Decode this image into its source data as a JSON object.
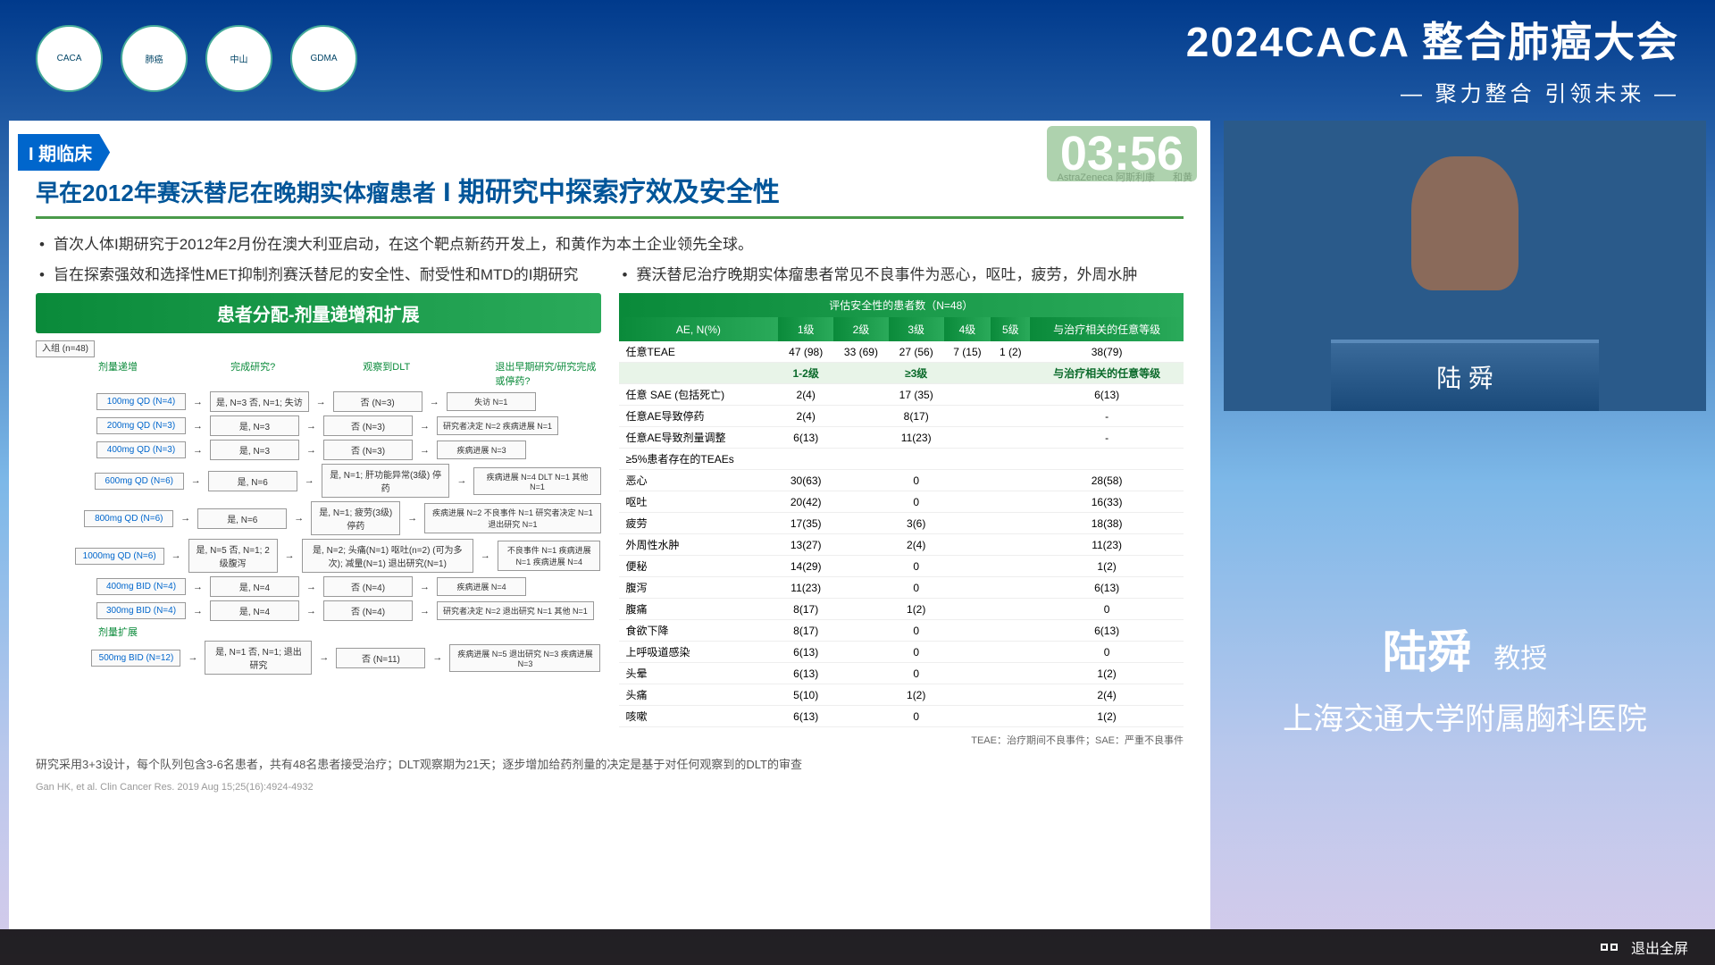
{
  "header": {
    "title": "2024CACA 整合肺癌大会",
    "subtitle": "— 聚力整合 引领未来 —",
    "logos": [
      "CACA",
      "肺癌",
      "中山",
      "GDMA"
    ]
  },
  "slide": {
    "phase_tag": "I 期临床",
    "timer": "03:56",
    "title_prefix": "早在2012年赛沃替尼在晚期实体瘤患者",
    "title_highlight": " I 期研究中探索疗效及安全性",
    "sponsors": [
      "AstraZeneca 阿斯利康",
      "和黄"
    ],
    "bullets": [
      "首次人体I期研究于2012年2月份在澳大利亚启动，在这个靶点新药开发上，和黄作为本土企业领先全球。",
      "旨在探索强效和选择性MET抑制剂赛沃替尼的安全性、耐受性和MTD的I期研究",
      "赛沃替尼治疗晚期实体瘤患者常见不良事件为恶心，呕吐，疲劳，外周水肿"
    ],
    "left_header": "患者分配-剂量递增和扩展",
    "flow_col_labels": [
      "剂量递增",
      "完成研究?",
      "观察到DLT",
      "退出早期研究/研究完成或停药?"
    ],
    "entry_label": "入组 (n=48)",
    "flow_rows": [
      {
        "dose": "100mg QD (N=4)",
        "c": "是, N=3 否, N=1; 失访",
        "d": "否 (N=3)",
        "o": "失访 N=1"
      },
      {
        "dose": "200mg QD (N=3)",
        "c": "是, N=3",
        "d": "否 (N=3)",
        "o": "研究者决定 N=2 疾病进展 N=1"
      },
      {
        "dose": "400mg QD (N=3)",
        "c": "是, N=3",
        "d": "否 (N=3)",
        "o": "疾病进展 N=3"
      },
      {
        "dose": "600mg QD (N=6)",
        "c": "是, N=6",
        "d": "是, N=1; 肝功能异常(3级) 停药",
        "o": "疾病进展 N=4 DLT N=1 其他 N=1"
      },
      {
        "dose": "800mg QD (N=6)",
        "c": "是, N=6",
        "d": "是, N=1; 疲劳(3级) 停药",
        "o": "疾病进展 N=2 不良事件 N=1 研究者决定 N=1 退出研究 N=1"
      },
      {
        "dose": "1000mg QD (N=6)",
        "c": "是, N=5 否, N=1; 2级腹泻",
        "d": "是, N=2; 头痛(N=1) 呕吐(n=2) (可为多次); 减量(N=1) 退出研究(N=1)",
        "o": "不良事件 N=1 疾病进展 N=1 疾病进展 N=4"
      },
      {
        "dose": "400mg BID (N=4)",
        "c": "是, N=4",
        "d": "否 (N=4)",
        "o": "疾病进展 N=4"
      },
      {
        "dose": "300mg BID (N=4)",
        "c": "是, N=4",
        "d": "否 (N=4)",
        "o": "研究者决定 N=2 退出研究 N=1 其他 N=1"
      },
      {
        "dose": "500mg BID (N=12)",
        "c": "是, N=1 否, N=1; 退出研究",
        "d": "否 (N=11)",
        "o": "疾病进展 N=5 退出研究 N=3 疾病进展 N=3"
      }
    ],
    "expansion_label": "剂量扩展",
    "table_header_main": "评估安全性的患者数（N=48）",
    "table_cols": [
      "AE, N(%)",
      "1级",
      "2级",
      "3级",
      "4级",
      "5级",
      "与治疗相关的任意等级"
    ],
    "r1": {
      "label": "任意TEAE",
      "v": [
        "47 (98)",
        "33 (69)",
        "27 (56)",
        "7 (15)",
        "1 (2)",
        "38(79)"
      ]
    },
    "sub_cols": [
      "",
      "1-2级",
      "",
      "≥3级",
      "",
      "",
      "与治疗相关的任意等级"
    ],
    "rows2": [
      {
        "l": "任意 SAE (包括死亡)",
        "a": "2(4)",
        "b": "17 (35)",
        "c": "6(13)"
      },
      {
        "l": "任意AE导致停药",
        "a": "2(4)",
        "b": "8(17)",
        "c": "-"
      },
      {
        "l": "任意AE导致剂量调整",
        "a": "6(13)",
        "b": "11(23)",
        "c": "-"
      }
    ],
    "sep_label": "≥5%患者存在的TEAEs",
    "ae_rows": [
      {
        "l": "恶心",
        "a": "30(63)",
        "b": "0",
        "c": "28(58)"
      },
      {
        "l": "呕吐",
        "a": "20(42)",
        "b": "0",
        "c": "16(33)"
      },
      {
        "l": "疲劳",
        "a": "17(35)",
        "b": "3(6)",
        "c": "18(38)"
      },
      {
        "l": "外周性水肿",
        "a": "13(27)",
        "b": "2(4)",
        "c": "11(23)"
      },
      {
        "l": "便秘",
        "a": "14(29)",
        "b": "0",
        "c": "1(2)"
      },
      {
        "l": "腹泻",
        "a": "11(23)",
        "b": "0",
        "c": "6(13)"
      },
      {
        "l": "腹痛",
        "a": "8(17)",
        "b": "1(2)",
        "c": "0"
      },
      {
        "l": "食欲下降",
        "a": "8(17)",
        "b": "0",
        "c": "6(13)"
      },
      {
        "l": "上呼吸道感染",
        "a": "6(13)",
        "b": "0",
        "c": "0"
      },
      {
        "l": "头晕",
        "a": "6(13)",
        "b": "0",
        "c": "1(2)"
      },
      {
        "l": "头痛",
        "a": "5(10)",
        "b": "1(2)",
        "c": "2(4)"
      },
      {
        "l": "咳嗽",
        "a": "6(13)",
        "b": "0",
        "c": "1(2)"
      }
    ],
    "footnote": "研究采用3+3设计，每个队列包含3-6名患者，共有48名患者接受治疗；DLT观察期为21天；逐步增加给药剂量的决定是基于对任何观察到的DLT的审查",
    "legend": "TEAE：治疗期间不良事件；SAE：严重不良事件",
    "citation": "Gan HK, et al. Clin Cancer Res. 2019 Aug 15;25(16):4924-4932"
  },
  "speaker": {
    "podium_name": "陆 舜",
    "name": "陆舜",
    "title": "教授",
    "org": "上海交通大学附属胸科医院"
  },
  "bottombar": {
    "exit_fullscreen": "退出全屏"
  }
}
